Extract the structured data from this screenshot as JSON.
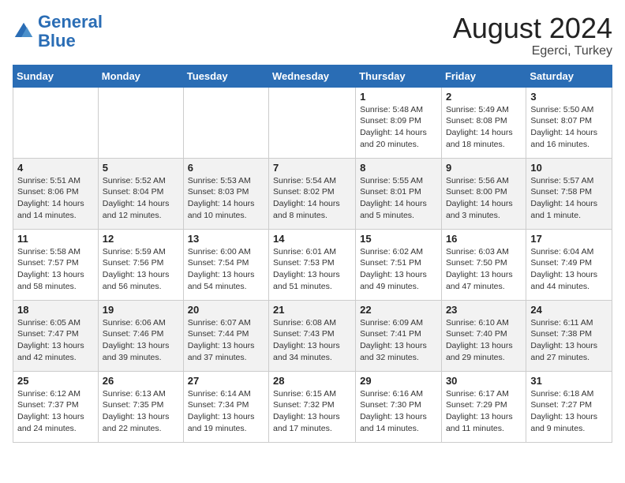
{
  "header": {
    "logo_general": "General",
    "logo_blue": "Blue",
    "month_year": "August 2024",
    "location": "Egerci, Turkey"
  },
  "weekdays": [
    "Sunday",
    "Monday",
    "Tuesday",
    "Wednesday",
    "Thursday",
    "Friday",
    "Saturday"
  ],
  "weeks": [
    [
      {
        "day": "",
        "info": ""
      },
      {
        "day": "",
        "info": ""
      },
      {
        "day": "",
        "info": ""
      },
      {
        "day": "",
        "info": ""
      },
      {
        "day": "1",
        "info": "Sunrise: 5:48 AM\nSunset: 8:09 PM\nDaylight: 14 hours\nand 20 minutes."
      },
      {
        "day": "2",
        "info": "Sunrise: 5:49 AM\nSunset: 8:08 PM\nDaylight: 14 hours\nand 18 minutes."
      },
      {
        "day": "3",
        "info": "Sunrise: 5:50 AM\nSunset: 8:07 PM\nDaylight: 14 hours\nand 16 minutes."
      }
    ],
    [
      {
        "day": "4",
        "info": "Sunrise: 5:51 AM\nSunset: 8:06 PM\nDaylight: 14 hours\nand 14 minutes."
      },
      {
        "day": "5",
        "info": "Sunrise: 5:52 AM\nSunset: 8:04 PM\nDaylight: 14 hours\nand 12 minutes."
      },
      {
        "day": "6",
        "info": "Sunrise: 5:53 AM\nSunset: 8:03 PM\nDaylight: 14 hours\nand 10 minutes."
      },
      {
        "day": "7",
        "info": "Sunrise: 5:54 AM\nSunset: 8:02 PM\nDaylight: 14 hours\nand 8 minutes."
      },
      {
        "day": "8",
        "info": "Sunrise: 5:55 AM\nSunset: 8:01 PM\nDaylight: 14 hours\nand 5 minutes."
      },
      {
        "day": "9",
        "info": "Sunrise: 5:56 AM\nSunset: 8:00 PM\nDaylight: 14 hours\nand 3 minutes."
      },
      {
        "day": "10",
        "info": "Sunrise: 5:57 AM\nSunset: 7:58 PM\nDaylight: 14 hours\nand 1 minute."
      }
    ],
    [
      {
        "day": "11",
        "info": "Sunrise: 5:58 AM\nSunset: 7:57 PM\nDaylight: 13 hours\nand 58 minutes."
      },
      {
        "day": "12",
        "info": "Sunrise: 5:59 AM\nSunset: 7:56 PM\nDaylight: 13 hours\nand 56 minutes."
      },
      {
        "day": "13",
        "info": "Sunrise: 6:00 AM\nSunset: 7:54 PM\nDaylight: 13 hours\nand 54 minutes."
      },
      {
        "day": "14",
        "info": "Sunrise: 6:01 AM\nSunset: 7:53 PM\nDaylight: 13 hours\nand 51 minutes."
      },
      {
        "day": "15",
        "info": "Sunrise: 6:02 AM\nSunset: 7:51 PM\nDaylight: 13 hours\nand 49 minutes."
      },
      {
        "day": "16",
        "info": "Sunrise: 6:03 AM\nSunset: 7:50 PM\nDaylight: 13 hours\nand 47 minutes."
      },
      {
        "day": "17",
        "info": "Sunrise: 6:04 AM\nSunset: 7:49 PM\nDaylight: 13 hours\nand 44 minutes."
      }
    ],
    [
      {
        "day": "18",
        "info": "Sunrise: 6:05 AM\nSunset: 7:47 PM\nDaylight: 13 hours\nand 42 minutes."
      },
      {
        "day": "19",
        "info": "Sunrise: 6:06 AM\nSunset: 7:46 PM\nDaylight: 13 hours\nand 39 minutes."
      },
      {
        "day": "20",
        "info": "Sunrise: 6:07 AM\nSunset: 7:44 PM\nDaylight: 13 hours\nand 37 minutes."
      },
      {
        "day": "21",
        "info": "Sunrise: 6:08 AM\nSunset: 7:43 PM\nDaylight: 13 hours\nand 34 minutes."
      },
      {
        "day": "22",
        "info": "Sunrise: 6:09 AM\nSunset: 7:41 PM\nDaylight: 13 hours\nand 32 minutes."
      },
      {
        "day": "23",
        "info": "Sunrise: 6:10 AM\nSunset: 7:40 PM\nDaylight: 13 hours\nand 29 minutes."
      },
      {
        "day": "24",
        "info": "Sunrise: 6:11 AM\nSunset: 7:38 PM\nDaylight: 13 hours\nand 27 minutes."
      }
    ],
    [
      {
        "day": "25",
        "info": "Sunrise: 6:12 AM\nSunset: 7:37 PM\nDaylight: 13 hours\nand 24 minutes."
      },
      {
        "day": "26",
        "info": "Sunrise: 6:13 AM\nSunset: 7:35 PM\nDaylight: 13 hours\nand 22 minutes."
      },
      {
        "day": "27",
        "info": "Sunrise: 6:14 AM\nSunset: 7:34 PM\nDaylight: 13 hours\nand 19 minutes."
      },
      {
        "day": "28",
        "info": "Sunrise: 6:15 AM\nSunset: 7:32 PM\nDaylight: 13 hours\nand 17 minutes."
      },
      {
        "day": "29",
        "info": "Sunrise: 6:16 AM\nSunset: 7:30 PM\nDaylight: 13 hours\nand 14 minutes."
      },
      {
        "day": "30",
        "info": "Sunrise: 6:17 AM\nSunset: 7:29 PM\nDaylight: 13 hours\nand 11 minutes."
      },
      {
        "day": "31",
        "info": "Sunrise: 6:18 AM\nSunset: 7:27 PM\nDaylight: 13 hours\nand 9 minutes."
      }
    ]
  ]
}
